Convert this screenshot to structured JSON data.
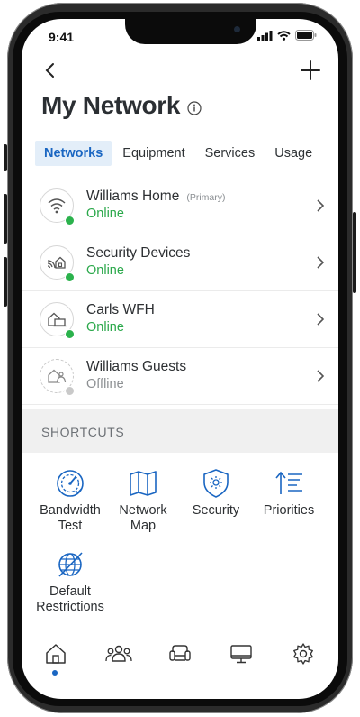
{
  "status": {
    "time": "9:41"
  },
  "header": {
    "title": "My Network"
  },
  "tabs": [
    {
      "label": "Networks",
      "active": true
    },
    {
      "label": "Equipment",
      "active": false
    },
    {
      "label": "Services",
      "active": false
    },
    {
      "label": "Usage",
      "active": false
    }
  ],
  "networks": [
    {
      "name": "Williams Home",
      "tag": "(Primary)",
      "status": "Online",
      "icon": "wifi-icon"
    },
    {
      "name": "Security Devices",
      "tag": "",
      "status": "Online",
      "icon": "security-home-icon"
    },
    {
      "name": "Carls WFH",
      "tag": "",
      "status": "Online",
      "icon": "home-office-icon"
    },
    {
      "name": "Williams Guests",
      "tag": "",
      "status": "Offline",
      "icon": "guest-home-icon"
    }
  ],
  "shortcuts": {
    "header": "SHORTCUTS",
    "items": [
      {
        "label": "Bandwidth Test",
        "line1": "Bandwidth",
        "line2": "Test",
        "icon": "speedometer-icon"
      },
      {
        "label": "Network Map",
        "line1": "Network",
        "line2": "Map",
        "icon": "map-icon"
      },
      {
        "label": "Security",
        "line1": "Security",
        "line2": "",
        "icon": "shield-icon"
      },
      {
        "label": "Priorities",
        "line1": "Priorities",
        "line2": "",
        "icon": "priorities-icon"
      },
      {
        "label": "Default Restrictions",
        "line1": "Default",
        "line2": "Restrictions",
        "icon": "restricted-globe-icon"
      }
    ]
  },
  "bottom_nav": [
    {
      "icon": "home-icon",
      "active": true
    },
    {
      "icon": "people-icon",
      "active": false
    },
    {
      "icon": "couch-icon",
      "active": false
    },
    {
      "icon": "monitor-icon",
      "active": false
    },
    {
      "icon": "gear-icon",
      "active": false
    }
  ],
  "colors": {
    "accent": "#1a66c2",
    "online": "#2aa84a",
    "tab_bg": "#e3eef9",
    "section_bg": "#f0f0f0"
  }
}
